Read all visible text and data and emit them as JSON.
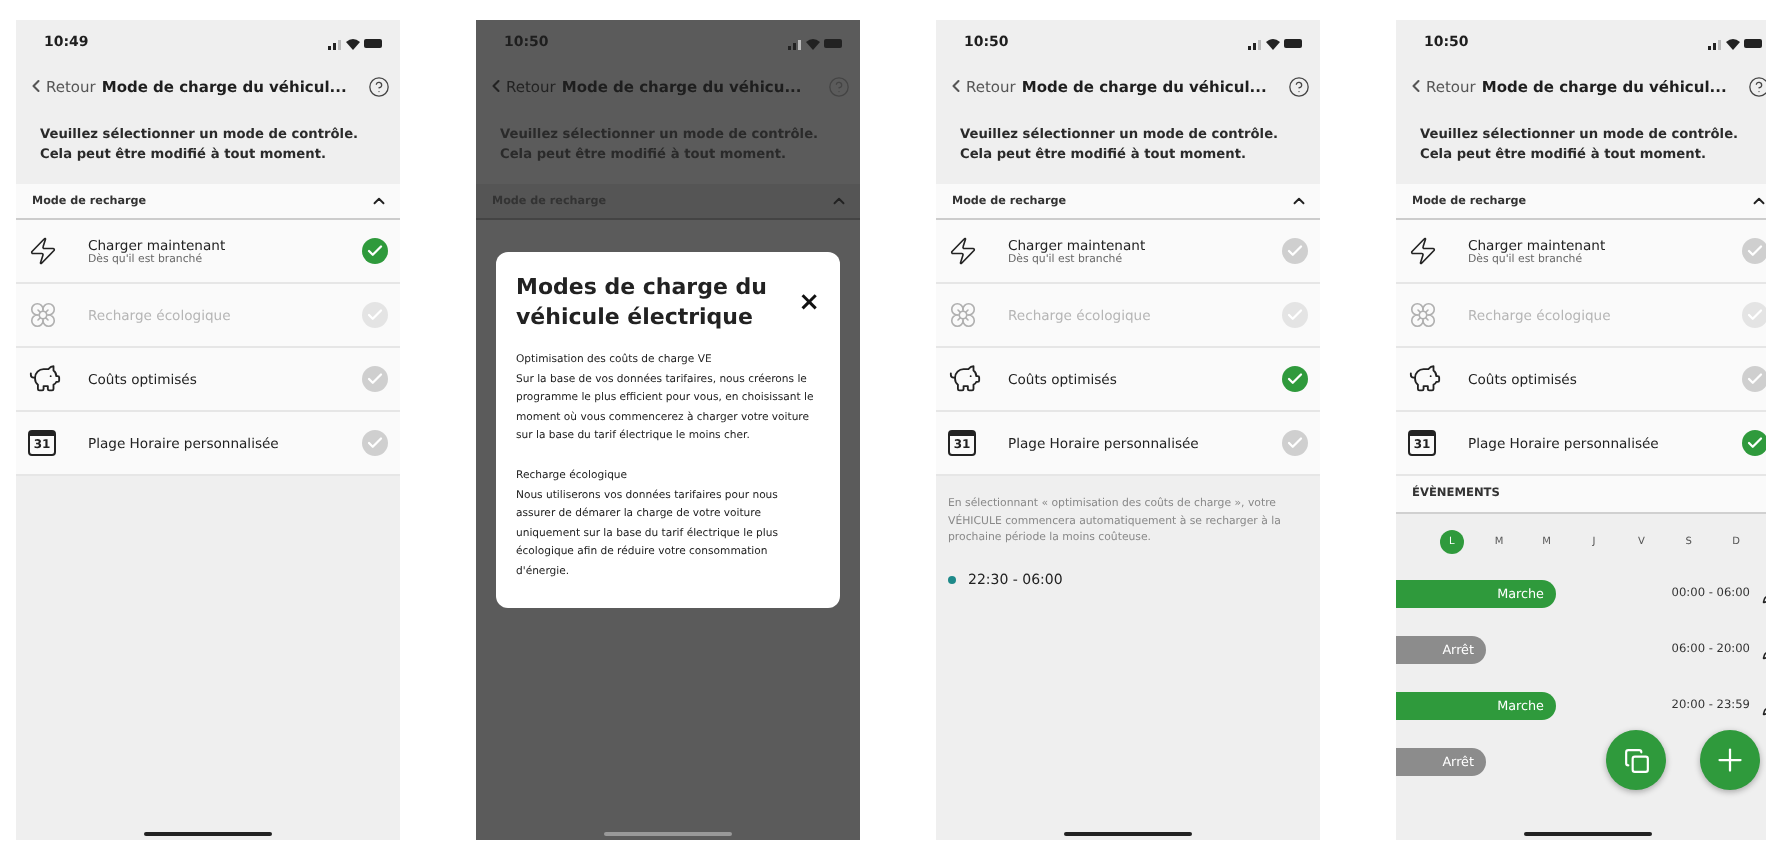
{
  "screens": [
    {
      "time": "10:49",
      "back": "Retour",
      "title": "Mode de charge du véhicul...",
      "intro": [
        "Veuillez sélectionner un mode de contrôle.",
        "Cela peut être modifié à tout moment."
      ],
      "section": "Mode de recharge",
      "dimmed": false,
      "modes": [
        {
          "kind": "bolt",
          "name": "Charger maintenant",
          "sub": "Dès qu'il est branché",
          "disabled": false,
          "selected": true
        },
        {
          "kind": "flower",
          "name": "Recharge écologique",
          "disabled": true,
          "selected": false
        },
        {
          "kind": "piggy",
          "name": "Coûts optimisés",
          "disabled": false,
          "selected": false
        },
        {
          "kind": "calendar",
          "name": "Plage Horaire personnalisée",
          "icon_label": "31",
          "disabled": false,
          "selected": false
        }
      ]
    },
    {
      "time": "10:50",
      "back": "Retour",
      "title": "Mode de charge du véhicu...",
      "intro": [
        "Veuillez sélectionner un mode de contrôle.",
        "Cela peut être modifié à tout moment."
      ],
      "section": "Mode de recharge",
      "dimmed": true,
      "modal": {
        "title": "Modes de charge du véhicule électrique",
        "close": "×",
        "sections": [
          {
            "heading": "Optimisation des coûts de charge VE",
            "body": "Sur la base de vos données tarifaires, nous créerons le programme le plus efficient pour vous, en choisissant le moment où vous commencerez à charger votre voiture sur la base du tarif électrique le moins cher."
          },
          {
            "heading": "Recharge écologique",
            "body": "Nous utiliserons vos données tarifaires pour nous assurer de démarer la charge de votre voiture uniquement sur la base du tarif électrique le plus écologique afin de réduire votre consommation d'énergie."
          }
        ]
      }
    },
    {
      "time": "10:50",
      "back": "Retour",
      "title": "Mode de charge du véhicul...",
      "intro": [
        "Veuillez sélectionner un mode de contrôle.",
        "Cela peut être modifié à tout moment."
      ],
      "section": "Mode de recharge",
      "dimmed": false,
      "modes": [
        {
          "kind": "bolt",
          "name": "Charger maintenant",
          "sub": "Dès qu'il est branché",
          "disabled": false,
          "selected": false
        },
        {
          "kind": "flower",
          "name": "Recharge écologique",
          "disabled": true,
          "selected": false
        },
        {
          "kind": "piggy",
          "name": "Coûts optimisés",
          "disabled": false,
          "selected": true
        },
        {
          "kind": "calendar",
          "name": "Plage Horaire personnalisée",
          "icon_label": "31",
          "disabled": false,
          "selected": false
        }
      ],
      "note": "En sélectionnant « optimisation des coûts de charge », votre VÉHICULE commencera automatiquement à se recharger à la prochaine période la moins coûteuse.",
      "slot": {
        "time": "22:30 - 06:00",
        "color": "#1e8a8a"
      }
    },
    {
      "time": "10:50",
      "back": "Retour",
      "title": "Mode de charge du véhicul...",
      "intro": [
        "Veuillez sélectionner un mode de contrôle.",
        "Cela peut être modifié à tout moment."
      ],
      "section": "Mode de recharge",
      "dimmed": false,
      "modes": [
        {
          "kind": "bolt",
          "name": "Charger maintenant",
          "sub": "Dès qu'il est branché",
          "disabled": false,
          "selected": false
        },
        {
          "kind": "flower",
          "name": "Recharge écologique",
          "disabled": true,
          "selected": false
        },
        {
          "kind": "piggy",
          "name": "Coûts optimisés",
          "disabled": false,
          "selected": false
        },
        {
          "kind": "calendar",
          "name": "Plage Horaire personnalisée",
          "icon_label": "31",
          "disabled": false,
          "selected": true
        }
      ],
      "events_title": "ÉVÈNEMENTS",
      "days": [
        {
          "label": "L",
          "selected": true
        },
        {
          "label": "M",
          "selected": false
        },
        {
          "label": "M",
          "selected": false
        },
        {
          "label": "J",
          "selected": false
        },
        {
          "label": "V",
          "selected": false
        },
        {
          "label": "S",
          "selected": false
        },
        {
          "label": "D",
          "selected": false
        }
      ],
      "events": [
        {
          "kind": "on",
          "label": "Marche",
          "time": "00:00 - 06:00"
        },
        {
          "kind": "off",
          "label": "Arrêt",
          "time": "06:00 - 20:00"
        },
        {
          "kind": "on",
          "label": "Marche",
          "time": "20:00 - 23:59"
        },
        {
          "kind": "off",
          "label": "Arrêt"
        }
      ],
      "fabs": [
        {
          "kind": "copy"
        },
        {
          "kind": "add"
        }
      ]
    }
  ]
}
